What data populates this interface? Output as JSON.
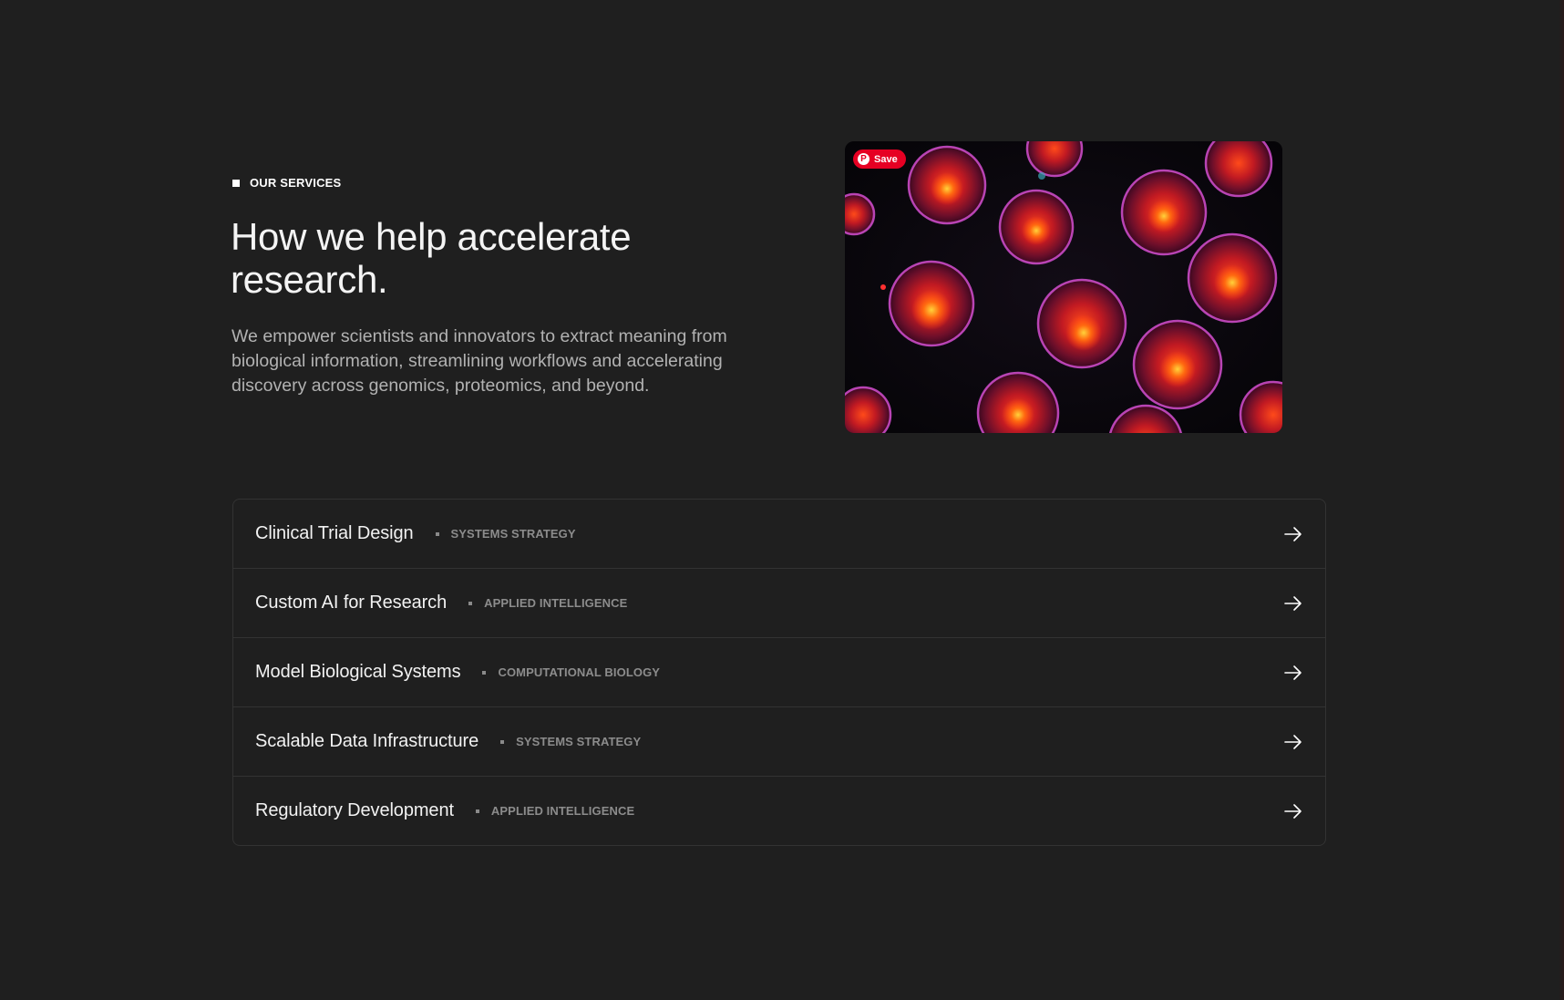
{
  "section": {
    "eyebrow": "OUR SERVICES",
    "headline": "How we help accelerate research.",
    "description": "We empower scientists and innovators to extract meaning from biological information, streamlining workflows and accelerating discovery across genomics, proteomics, and beyond."
  },
  "hero_image": {
    "save_label": "Save",
    "pin_glyph": "P",
    "save_color": "#e60023",
    "icon": "microscope-cells-image"
  },
  "services": [
    {
      "title": "Clinical Trial Design",
      "tag": "SYSTEMS STRATEGY"
    },
    {
      "title": "Custom AI for Research",
      "tag": "APPLIED INTELLIGENCE"
    },
    {
      "title": "Model Biological Systems",
      "tag": "COMPUTATIONAL BIOLOGY"
    },
    {
      "title": "Scalable Data Infrastructure",
      "tag": "SYSTEMS STRATEGY"
    },
    {
      "title": "Regulatory Development",
      "tag": "APPLIED INTELLIGENCE"
    }
  ],
  "colors": {
    "background": "#1f1f1f",
    "border": "#333333",
    "muted_text": "#8c8c8c"
  }
}
